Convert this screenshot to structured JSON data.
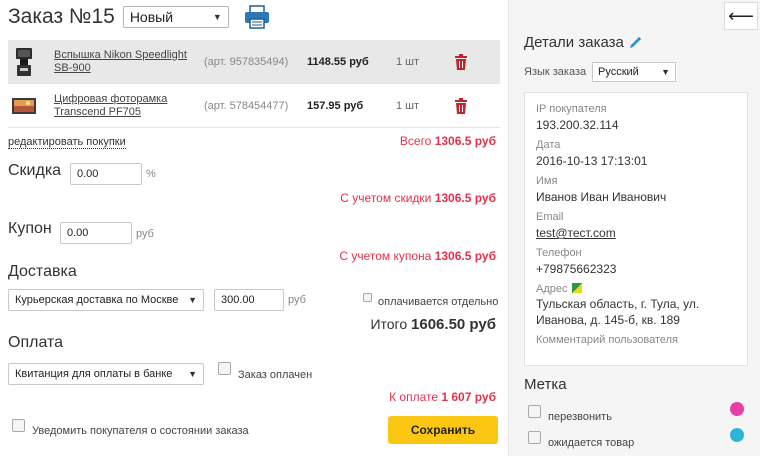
{
  "header": {
    "title": "Заказ №15",
    "status": "Новый"
  },
  "items": [
    {
      "name": "Вспышка Nikon Speedlight SB-900",
      "sku": "(арт. 957835494)",
      "price": "1148.55 руб",
      "qty": "1 шт"
    },
    {
      "name": "Цифровая фоторамка Transcend PF705",
      "sku": "(арт. 578454477)",
      "price": "157.95 руб",
      "qty": "1 шт"
    }
  ],
  "edit_purchases": "редактировать покупки",
  "total": {
    "label": "Всего",
    "value": "1306.5 руб"
  },
  "discount": {
    "label": "Скидка",
    "value": "0.00",
    "unit": "%",
    "result_label": "С учетом скидки",
    "result_value": "1306.5 руб"
  },
  "coupon": {
    "label": "Купон",
    "value": "0.00",
    "unit": "руб",
    "result_label": "С учетом купона",
    "result_value": "1306.5 руб"
  },
  "delivery": {
    "label": "Доставка",
    "method": "Курьерская доставка по Москве",
    "cost": "300.00",
    "unit": "руб",
    "separate_label": "оплачивается отдельно"
  },
  "grand_total": {
    "label": "Итого",
    "value": "1606.50 руб"
  },
  "payment": {
    "label": "Оплата",
    "method": "Квитанция для оплаты в банке",
    "paid_label": "Заказ оплачен"
  },
  "to_pay": {
    "label": "К оплате",
    "value": "1 607 руб"
  },
  "notify_label": "Уведомить покупателя о состоянии заказа",
  "save_label": "Сохранить",
  "back_label": "⟵",
  "details": {
    "title": "Детали заказа",
    "lang_label": "Язык заказа",
    "lang_value": "Русский",
    "fields": [
      {
        "label": "IP покупателя",
        "value": "193.200.32.114"
      },
      {
        "label": "Дата",
        "value": "2016-10-13 17:13:01"
      },
      {
        "label": "Имя",
        "value": "Иванов Иван Иванович"
      },
      {
        "label": "Email",
        "value": "test@тест.com"
      },
      {
        "label": "Телефон",
        "value": "+79875662323"
      },
      {
        "label": "Адрес",
        "value": "Тульская область, г. Тула, ул. Иванова, д. 145-б, кв. 189"
      }
    ],
    "comment_label": "Комментарий пользователя"
  },
  "marks": {
    "title": "Метка",
    "items": [
      {
        "label": "перезвонить",
        "color": "#e83ea8"
      },
      {
        "label": "ожидается товар",
        "color": "#2fb3d8"
      }
    ]
  },
  "colors": {
    "accent_red": "#e0324f",
    "save_yellow": "#fcc713",
    "trash_red": "#c0242e",
    "pencil_blue": "#2f8fd8"
  }
}
